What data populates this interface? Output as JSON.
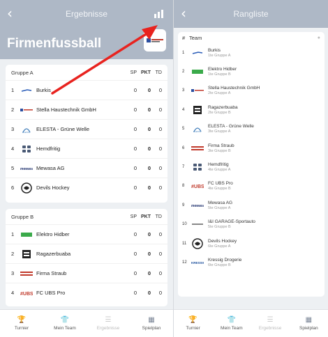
{
  "left": {
    "back_glyph": "‹",
    "title": "Ergebnisse",
    "chart_icon": "bar-chart-icon",
    "tournament_name": "Firmenfussball",
    "sponsor_logo_icon": "sponsor-logo",
    "columns": {
      "sp": "SP",
      "pkt": "PKT",
      "td": "TD"
    },
    "groups": [
      {
        "name": "Gruppe A",
        "rows": [
          {
            "rank": "1",
            "logo": "burkis-logo",
            "team": "Burkis",
            "sp": "0",
            "pkt": "0",
            "td": "0"
          },
          {
            "rank": "2",
            "logo": "stella-logo",
            "team": "Stella Haustechnik GmbH",
            "sp": "0",
            "pkt": "0",
            "td": "0"
          },
          {
            "rank": "3",
            "logo": "elesta-logo",
            "team": "ELESTA - Grüne Welle",
            "sp": "0",
            "pkt": "0",
            "td": "0"
          },
          {
            "rank": "4",
            "logo": "hemdfritig-logo",
            "team": "Hemdfritig",
            "sp": "0",
            "pkt": "0",
            "td": "0"
          },
          {
            "rank": "5",
            "logo": "mewasa-logo",
            "team": "Mewasa AG",
            "sp": "0",
            "pkt": "0",
            "td": "0"
          },
          {
            "rank": "6",
            "logo": "devils-logo",
            "team": "Devils Hockey",
            "sp": "0",
            "pkt": "0",
            "td": "0"
          }
        ]
      },
      {
        "name": "Gruppe B",
        "rows": [
          {
            "rank": "1",
            "logo": "elektro-logo",
            "team": "Elektro Hidber",
            "sp": "0",
            "pkt": "0",
            "td": "0"
          },
          {
            "rank": "2",
            "logo": "ragazer-logo",
            "team": "Ragazerbuaba",
            "sp": "0",
            "pkt": "0",
            "td": "0"
          },
          {
            "rank": "3",
            "logo": "straub-logo",
            "team": "Firma Straub",
            "sp": "0",
            "pkt": "0",
            "td": "0"
          },
          {
            "rank": "4",
            "logo": "ubs-logo",
            "team": "FC UBS Pro",
            "sp": "0",
            "pkt": "0",
            "td": "0"
          }
        ]
      }
    ],
    "tabs": [
      {
        "label": "Turnier",
        "icon": "trophy-icon",
        "dim": false
      },
      {
        "label": "Mein Team",
        "icon": "shirt-icon",
        "dim": false
      },
      {
        "label": "Ergebnisse",
        "icon": "list-icon",
        "dim": true
      },
      {
        "label": "Spielplan",
        "icon": "calendar-icon",
        "dim": false
      }
    ]
  },
  "right": {
    "back_glyph": "‹",
    "title": "Rangliste",
    "header_hash": "#",
    "header_team": "Team",
    "rows": [
      {
        "rank": "1",
        "logo": "burkis-logo",
        "team": "Burkis",
        "sub": "1te Gruppe A"
      },
      {
        "rank": "2",
        "logo": "elektro-logo",
        "team": "Elektro Hidber",
        "sub": "1te Gruppe B"
      },
      {
        "rank": "3",
        "logo": "stella-logo",
        "team": "Stella Haustechnik GmbH",
        "sub": "2te Gruppe A"
      },
      {
        "rank": "4",
        "logo": "ragazer-logo",
        "team": "Ragazerbuaba",
        "sub": "2te Gruppe B"
      },
      {
        "rank": "5",
        "logo": "elesta-logo",
        "team": "ELESTA - Grüne Welle",
        "sub": "3te Gruppe A"
      },
      {
        "rank": "6",
        "logo": "straub-logo",
        "team": "Firma Straub",
        "sub": "3te Gruppe B"
      },
      {
        "rank": "7",
        "logo": "hemdfritig-logo",
        "team": "Hemdfritig",
        "sub": "4te Gruppe A"
      },
      {
        "rank": "8",
        "logo": "ubs-logo",
        "team": "FC UBS Pro",
        "sub": "4te Gruppe B"
      },
      {
        "rank": "9",
        "logo": "mewasa-logo",
        "team": "Mewasa AG",
        "sub": "5te Gruppe A"
      },
      {
        "rank": "10",
        "logo": "garage-logo",
        "team": "I&I GARAGE-Sportauto",
        "sub": "5te Gruppe B"
      },
      {
        "rank": "11",
        "logo": "devils-logo",
        "team": "Devils Hockey",
        "sub": "6te Gruppe A"
      },
      {
        "rank": "12",
        "logo": "kressig-logo",
        "team": "Kressig Drogerie",
        "sub": "6te Gruppe B"
      }
    ],
    "tabs": [
      {
        "label": "Turnier",
        "icon": "trophy-icon",
        "dim": false
      },
      {
        "label": "Mein Team",
        "icon": "shirt-icon",
        "dim": false
      },
      {
        "label": "Ergebnisse",
        "icon": "list-icon",
        "dim": true
      },
      {
        "label": "Spielplan",
        "icon": "calendar-icon",
        "dim": false
      }
    ]
  },
  "colors": {
    "header": "#aeb8c6",
    "annotation_arrow": "#e8231f"
  }
}
